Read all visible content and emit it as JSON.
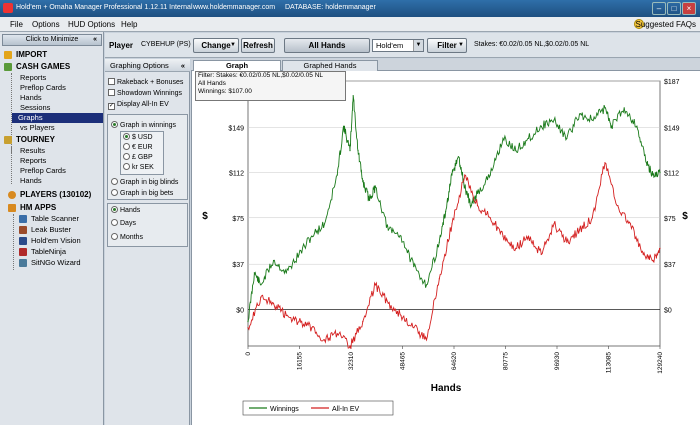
{
  "window": {
    "title": "Hold'em + Omaha Manager Professional 1.12.11 Internal",
    "url": "www.holdemmanager.com",
    "database": "DATABASE: holdemmanager"
  },
  "menu": {
    "items": [
      "File",
      "Options",
      "HUD Options",
      "Help"
    ],
    "suggested_features": "Suggested FAQs"
  },
  "sidebar": {
    "minimize_label": "Click to Minimize",
    "import": "IMPORT",
    "cash_games": {
      "label": "CASH GAMES",
      "items": [
        "Reports",
        "Preflop Cards",
        "Hands",
        "Sessions",
        "Graphs",
        "vs Players"
      ],
      "selected": "Graphs"
    },
    "tourney": {
      "label": "TOURNEY",
      "items": [
        "Results",
        "Reports",
        "Preflop Cards",
        "Hands"
      ]
    },
    "players": "PLAYERS (130102)",
    "hm_apps": {
      "label": "HM APPS",
      "items": [
        "Table Scanner",
        "Leak Buster",
        "Hold'em Vision",
        "TableNinja",
        "SitNGo Wizard"
      ]
    }
  },
  "toolbar": {
    "player_label": "Player",
    "player_value": "CYBEHUP (PS)",
    "change": "Change",
    "refresh": "Refresh",
    "all_hands": "All Hands",
    "game": "Hold'em",
    "filter": "Filter",
    "stakes": "Stakes: €0.02/0.05 NL,$0.02/0.05 NL"
  },
  "graph_options": {
    "title": "Graphing Options",
    "checkboxes": [
      {
        "label": "Rakeback + Bonuses",
        "checked": false
      },
      {
        "label": "Showdown Winnings",
        "checked": false
      },
      {
        "label": "Display All-In EV",
        "checked": true
      }
    ],
    "graph_in_winnings": "Graph in winnings",
    "currencies": [
      "$ USD",
      "€ EUR",
      "£ GBP",
      "kr SEK"
    ],
    "graph_in_big_blinds": "Graph in big blinds",
    "graph_in_big_bets": "Graph in big bets",
    "x_modes": [
      "Hands",
      "Days",
      "Months"
    ]
  },
  "tabs": {
    "graph": "Graph",
    "graphed_hands": "Graphed Hands"
  },
  "filter_box": {
    "line1": "Filter: Stakes: €0.02/0.05 NL,$0.02/0.05 NL",
    "line2": "All Hands",
    "line3": "Winnings: $107.00"
  },
  "chart_data": {
    "type": "line",
    "xlabel": "Hands",
    "ylabel": "$",
    "xlim": [
      0,
      129240
    ],
    "ylim": [
      -30,
      187
    ],
    "x_ticks": [
      0,
      16155,
      32310,
      48465,
      64620,
      80775,
      96930,
      113085,
      129240
    ],
    "y_ticks": [
      0,
      37,
      75,
      112,
      149,
      187
    ],
    "y_tick_labels": [
      "$0",
      "$37",
      "$75",
      "$112",
      "$149",
      "$187"
    ],
    "legend_position": "bottom-center",
    "series": [
      {
        "name": "Winnings",
        "color": "#1a7a1a",
        "x": [
          0,
          2000,
          4000,
          8000,
          12000,
          16000,
          20000,
          24000,
          28000,
          30000,
          32000,
          33000,
          34500,
          36000,
          38000,
          40000,
          44000,
          48000,
          52000,
          56000,
          60000,
          62000,
          64000,
          66000,
          68000,
          70000,
          72000,
          76000,
          80000,
          84000,
          88000,
          92000,
          96000,
          100000,
          104000,
          108000,
          112000,
          114000,
          118000,
          122000,
          125000,
          127000,
          129240
        ],
        "values": [
          -10,
          30,
          20,
          40,
          30,
          45,
          60,
          70,
          110,
          150,
          130,
          175,
          130,
          105,
          90,
          100,
          65,
          60,
          35,
          20,
          55,
          80,
          110,
          125,
          100,
          85,
          95,
          110,
          140,
          130,
          140,
          150,
          155,
          140,
          160,
          155,
          165,
          150,
          165,
          150,
          120,
          110,
          112
        ]
      },
      {
        "name": "All-In EV",
        "color": "#d42020",
        "x": [
          0,
          4000,
          8000,
          12000,
          16000,
          20000,
          24000,
          28000,
          32000,
          36000,
          40000,
          44000,
          48000,
          52000,
          56000,
          60000,
          64000,
          68000,
          72000,
          76000,
          80000,
          84000,
          88000,
          92000,
          96000,
          100000,
          104000,
          108000,
          112000,
          116000,
          120000,
          124000,
          127000,
          129240
        ],
        "values": [
          -15,
          10,
          5,
          -5,
          -10,
          -15,
          -25,
          -20,
          -30,
          -10,
          20,
          5,
          -5,
          -15,
          -25,
          25,
          70,
          110,
          85,
          75,
          60,
          50,
          60,
          45,
          70,
          55,
          65,
          75,
          120,
          85,
          70,
          45,
          40,
          50
        ]
      }
    ]
  }
}
